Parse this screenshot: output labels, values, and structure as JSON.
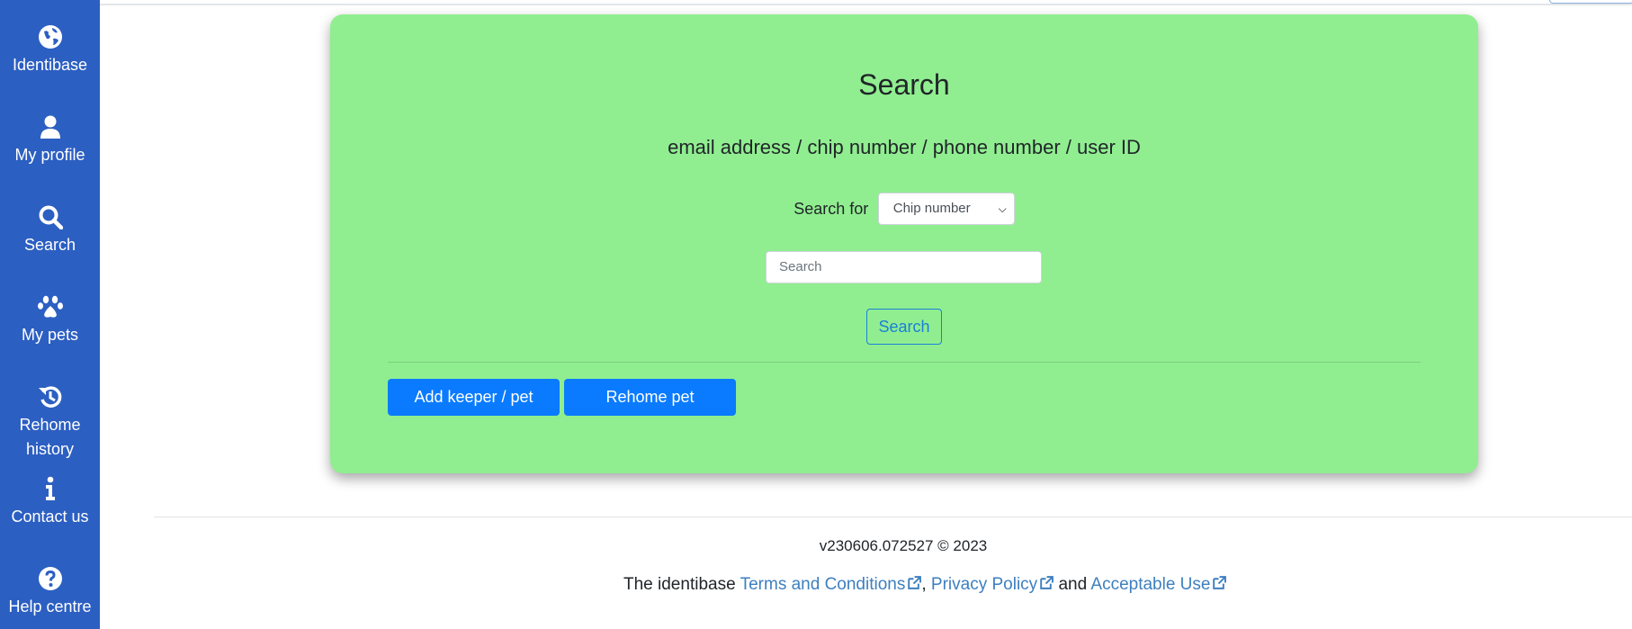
{
  "sidebar": {
    "items": [
      {
        "label": "Identibase",
        "icon": "globe-icon"
      },
      {
        "label": "My profile",
        "icon": "user-icon"
      },
      {
        "label": "Search",
        "icon": "search-icon"
      },
      {
        "label": "My pets",
        "icon": "paw-icon"
      },
      {
        "label": "Rehome history",
        "icon": "history-icon"
      },
      {
        "label": "Contact us",
        "icon": "info-icon"
      },
      {
        "label": "Help centre",
        "icon": "question-circle-icon"
      }
    ],
    "color": "#2c5fc2"
  },
  "card": {
    "title": "Search",
    "subtitle": "email address / chip number / phone number / user ID",
    "search_for_label": "Search for",
    "select_value": "Chip number",
    "search_placeholder": "Search",
    "search_button": "Search",
    "add_button": "Add keeper / pet",
    "rehome_button": "Rehome pet",
    "background": "#90ee90"
  },
  "footer": {
    "version": "v230606.072527 © 2023",
    "prefix": "The identibase",
    "terms": "Terms and Conditions",
    "comma": ",",
    "privacy": "Privacy Policy",
    "and": "and",
    "acceptable": "Acceptable Use"
  }
}
